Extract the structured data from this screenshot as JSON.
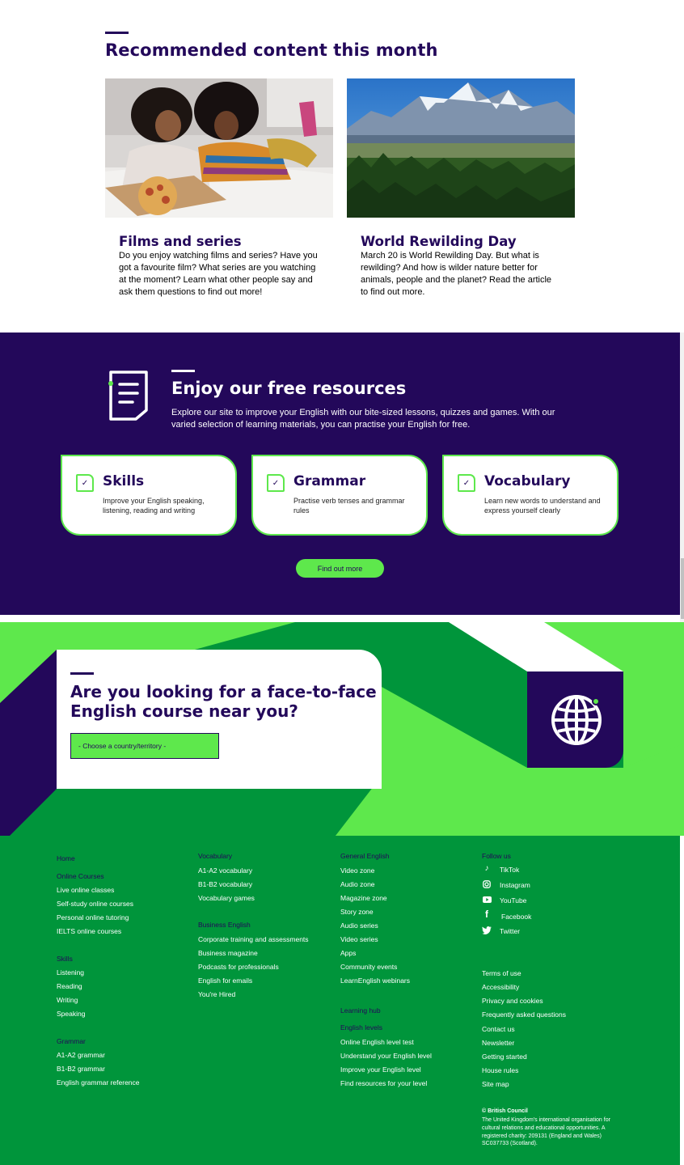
{
  "recommended": {
    "title": "Recommended content this month",
    "cards": [
      {
        "title": "Films and series",
        "text": "Do you enjoy watching films and series? Have you got a favourite film? What series are you watching at the moment? Learn what other people say and ask them questions to find out more!",
        "image": "two-women-eating-pizza-photo"
      },
      {
        "title": "World Rewilding Day",
        "text": "March 20 is World Rewilding Day. But what is rewilding? And how is wilder nature better for animals, people and the planet? Read the article to find out more.",
        "image": "mountain-forest-river-photo"
      }
    ]
  },
  "resources": {
    "title": "Enjoy our free resources",
    "text": "Explore our site to improve your English with our bite-sized lessons, quizzes and games. With our varied selection of learning materials, you can practise your English for free.",
    "cards": [
      {
        "title": "Skills",
        "text": "Improve your English speaking, listening, reading and writing"
      },
      {
        "title": "Grammar",
        "text": "Practise verb tenses and grammar rules"
      },
      {
        "title": "Vocabulary",
        "text": "Learn new words to understand and express yourself clearly"
      }
    ],
    "button": "Find out more"
  },
  "face_to_face": {
    "title": "Are you looking for a face-to-face English course near you?",
    "select_value": "- Choose a country/territory -",
    "icon": "globe-icon"
  },
  "footer": {
    "col1": {
      "home": "Home",
      "online_head": "Online Courses",
      "online_links": [
        "Live online classes",
        "Self-study online courses",
        "Personal online tutoring",
        "IELTS online courses"
      ],
      "skills_head": "Skills",
      "skills_links": [
        "Listening",
        "Reading",
        "Writing",
        "Speaking"
      ],
      "grammar_head": "Grammar",
      "grammar_links": [
        "A1-A2 grammar",
        "B1-B2 grammar",
        "English grammar reference"
      ]
    },
    "col2": {
      "vocab_head": "Vocabulary",
      "vocab_links": [
        "A1-A2 vocabulary",
        "B1-B2 vocabulary",
        "Vocabulary games"
      ],
      "business_head": "Business English",
      "business_links": [
        "Corporate training and assessments",
        "Business magazine",
        "Podcasts for professionals",
        "English for emails",
        "You're Hired"
      ]
    },
    "col3": {
      "general_head": "General English",
      "general_links": [
        "Video zone",
        "Audio zone",
        "Magazine zone",
        "Story zone",
        "Audio series",
        "Video series",
        "Apps",
        "Community events",
        "LearnEnglish webinars"
      ],
      "hub_head": "Learning hub",
      "levels_head": "English levels",
      "levels_links": [
        "Online English level test",
        "Understand your English level",
        "Improve your English level",
        "Find resources for your level"
      ]
    },
    "col4": {
      "follow_head": "Follow us",
      "social": [
        {
          "label": "TikTok",
          "icon": "tiktok-icon"
        },
        {
          "label": "Instagram",
          "icon": "instagram-icon"
        },
        {
          "label": "YouTube",
          "icon": "youtube-icon"
        },
        {
          "label": "Facebook",
          "icon": "facebook-icon"
        },
        {
          "label": "Twitter",
          "icon": "twitter-icon"
        }
      ],
      "legal_links": [
        "Terms of use",
        "Accessibility",
        "Privacy and cookies",
        "Frequently asked questions",
        "Contact us",
        "Newsletter",
        "Getting started",
        "House rules",
        "Site map"
      ],
      "copyright_head": "© British Council",
      "copyright_text": "The United Kingdom's international organisation for cultural relations and educational opportunities. A registered charity: 209131 (England and Wales) SC037733 (Scotland)."
    }
  },
  "colors": {
    "brand_purple": "#23085a",
    "brand_green": "#5ee84c",
    "dark_green": "#00953b"
  }
}
